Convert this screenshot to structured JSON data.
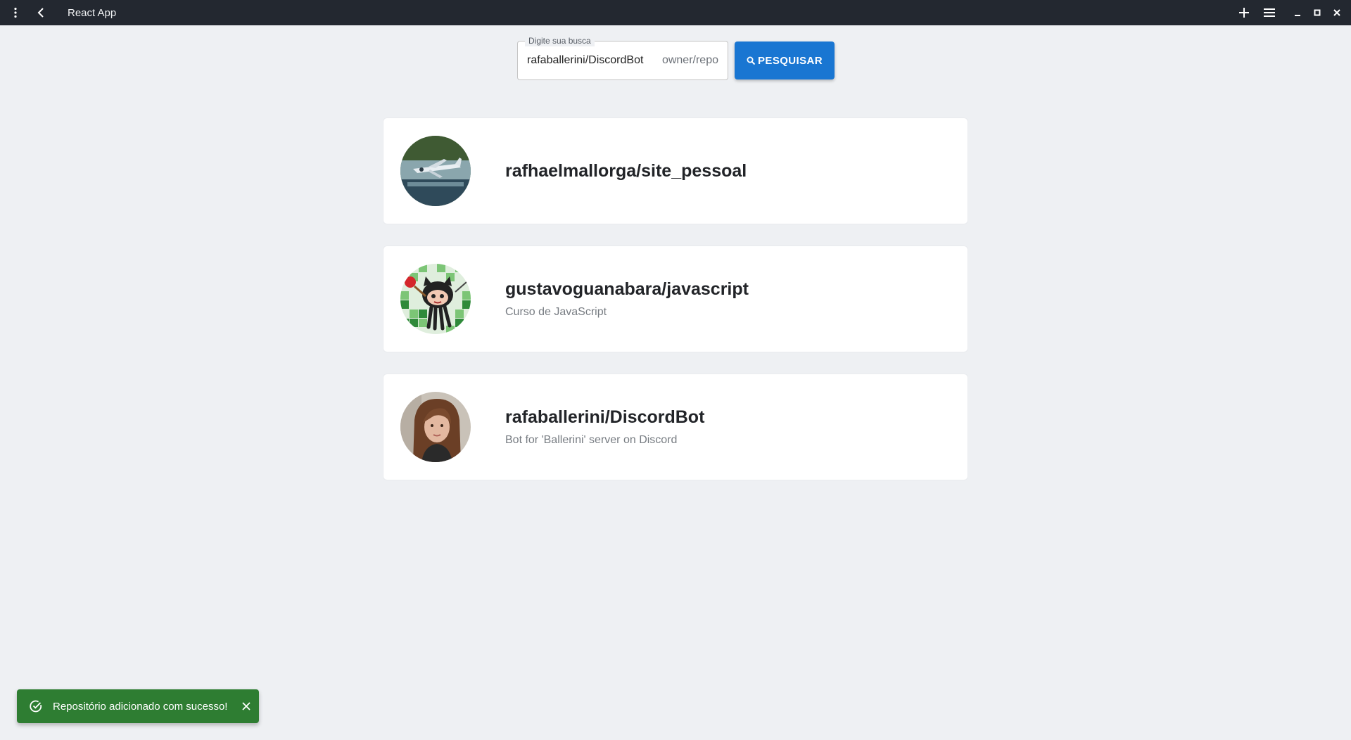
{
  "titlebar": {
    "title": "React App",
    "icons": [
      "more-vert-icon",
      "back-icon",
      "plus-icon",
      "hamburger-menu-icon",
      "minimize-icon",
      "maximize-icon",
      "close-icon"
    ]
  },
  "search": {
    "label": "Digite sua busca",
    "value": "rafaballerini/DiscordBot",
    "hint": "owner/repo",
    "button_label": "PESQUISAR",
    "button_icon": "search-icon"
  },
  "repos": [
    {
      "name": "rafhaelmallorga/site_pessoal",
      "description": "",
      "avatar": "airplane-photo-avatar"
    },
    {
      "name": "gustavoguanabara/javascript",
      "description": "Curso de JavaScript",
      "avatar": "octocat-mosaic-avatar"
    },
    {
      "name": "rafaballerini/DiscordBot",
      "description": "Bot for 'Ballerini' server on Discord",
      "avatar": "person-photo-avatar"
    }
  ],
  "snackbar": {
    "message": "Repositório adicionado com sucesso!",
    "icon": "check-circle-icon",
    "close_icon": "close-icon"
  },
  "colors": {
    "titlebar": "#232830",
    "background": "#eef0f3",
    "primary": "#1976d2",
    "success": "#2e7d32"
  }
}
